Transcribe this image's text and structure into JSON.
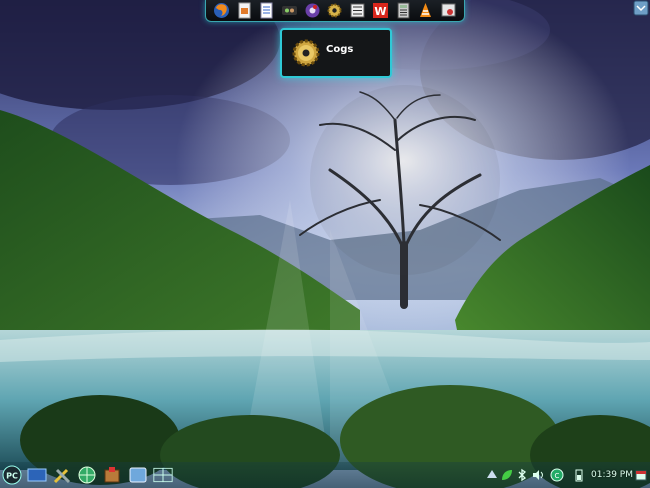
{
  "dock": {
    "items": [
      {
        "icon": "firefox-icon"
      },
      {
        "icon": "document-viewer-icon"
      },
      {
        "icon": "text-document-icon"
      },
      {
        "icon": "terminal-icon"
      },
      {
        "icon": "media-player-icon"
      },
      {
        "icon": "cogs-icon"
      },
      {
        "icon": "mahjong-icon"
      },
      {
        "icon": "wordprocessor-icon"
      },
      {
        "icon": "calculator-icon"
      },
      {
        "icon": "vlc-icon"
      },
      {
        "icon": "control-panel-icon"
      }
    ]
  },
  "tooltip": {
    "label": "Cogs",
    "icon": "cogs-icon"
  },
  "panel": {
    "start_label": "PC",
    "clock": "01:39 PM"
  },
  "colors": {
    "accent": "#2fc9d6",
    "dock_bg": "#0a0c0f"
  }
}
